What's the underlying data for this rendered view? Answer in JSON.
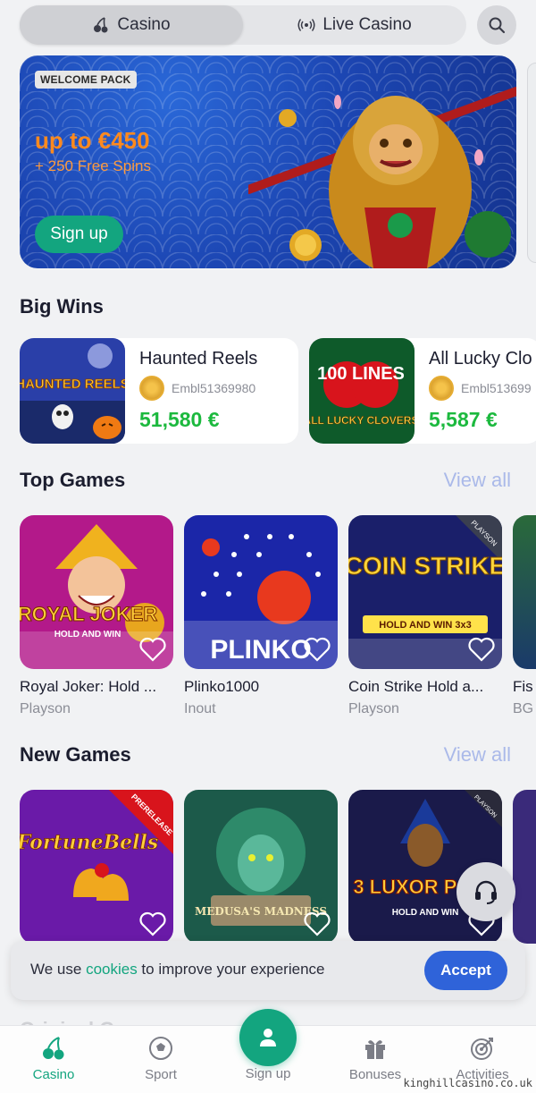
{
  "tabs": {
    "casino": "Casino",
    "live_casino": "Live Casino"
  },
  "banner": {
    "badge": "WELCOME PACK",
    "headline": "up to €450",
    "sub": "+ 250 Free Spins",
    "cta": "Sign up"
  },
  "big_wins": {
    "title": "Big Wins",
    "items": [
      {
        "game": "Haunted Reels",
        "player": "Embl51369980",
        "amount": "51,580 €",
        "art_title": "HAUNTED REELS"
      },
      {
        "game": "All Lucky Clo",
        "player": "Embl513699",
        "amount": "5,587 €",
        "art_title": "ALL LUCKY CLOVERS",
        "art_badge": "100 LINES"
      }
    ]
  },
  "top_games": {
    "title": "Top Games",
    "view_all": "View all",
    "items": [
      {
        "name": "Royal Joker: Hold ...",
        "provider": "Playson",
        "art_title": "ROYAL JOKER",
        "art_sub": "HOLD AND WIN"
      },
      {
        "name": "Plinko1000",
        "provider": "Inout",
        "art_title": "PLINKO"
      },
      {
        "name": "Coin Strike Hold a...",
        "provider": "Playson",
        "art_title": "COIN STRIKE",
        "art_sub": "HOLD AND WIN 3x3",
        "art_badge": "PLAYSON"
      },
      {
        "name": "Fis",
        "provider": "BG"
      }
    ]
  },
  "new_games": {
    "title": "New Games",
    "view_all": "View all",
    "items": [
      {
        "name": "",
        "provider": "",
        "art_title": "FortuneBells",
        "art_badge": "PRERELEASE"
      },
      {
        "name": "",
        "provider": "",
        "art_title": "MEDUSA'S MADNESS"
      },
      {
        "name": "",
        "provider": "",
        "art_title": "3 LUXOR POTS",
        "art_sub": "HOLD AND WIN",
        "art_badge": "PLAYSON"
      }
    ]
  },
  "partial_section": "Original G",
  "cookie": {
    "prefix": "We use ",
    "link": "cookies",
    "suffix": " to improve your experience",
    "accept": "Accept"
  },
  "nav": {
    "casino": "Casino",
    "sport": "Sport",
    "signup": "Sign up",
    "bonuses": "Bonuses",
    "activities": "Activities"
  },
  "watermark": "kinghillcasino.co.uk",
  "colors": {
    "brand_green": "#13a57f",
    "win_green": "#1cb93e",
    "accent_blue": "#2f63d9",
    "orange": "#ff8a1e"
  }
}
